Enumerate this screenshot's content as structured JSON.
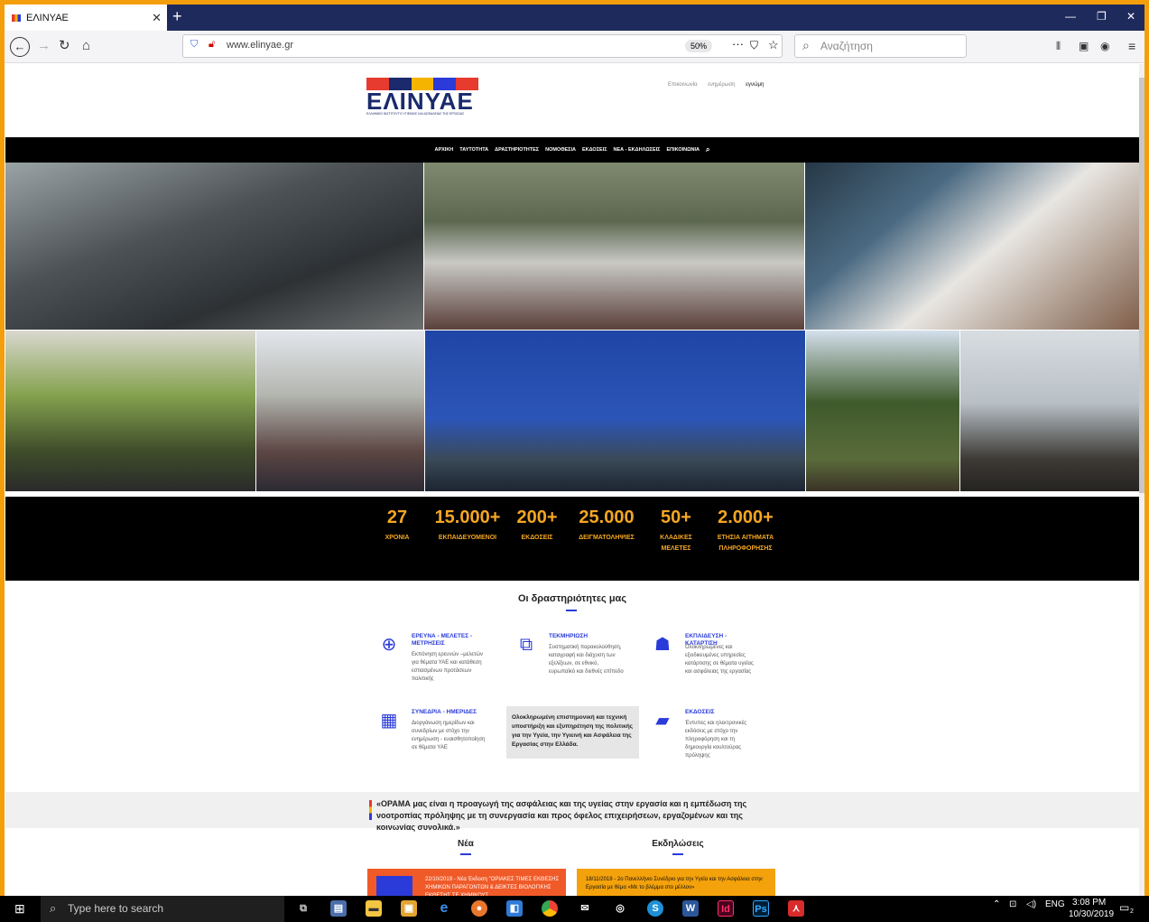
{
  "browser": {
    "tab_title": "ΕΛΙΝΥΑΕ",
    "url": "www.elinyae.gr",
    "zoom": "50%",
    "search_placeholder": "Αναζήτηση"
  },
  "site": {
    "logo_text": "ΕΛΙΝΥΑΕ",
    "logo_subtitle": "ΕΛΛΗΝΙΚΟ ΙΝΣΤΙΤΟΥΤΟ ΥΓΙΕΙΝΗΣ ΚΑΙ ΑΣΦΑΛΕΙΑΣ ΤΗΣ ΕΡΓΑΣΙΑΣ",
    "top_links": [
      "Επικοινωνία",
      "ενημέρωση",
      "εγνώμη"
    ],
    "menu": [
      "ΑΡΧΙΚΗ",
      "ΤΑΥΤΟΤΗΤΑ",
      "ΔΡΑΣΤΗΡΙΟΤΗΤΕΣ",
      "ΝΟΜΟΘΕΣΙΑ",
      "ΕΚΔΟΣΕΙΣ",
      "ΝΕΑ - ΕΚΔΗΛΩΣΕΙΣ",
      "ΕΠΙΚΟΙΝΩΝΙΑ"
    ]
  },
  "stats": [
    {
      "value": "27",
      "label": "ΧΡΟΝΙΑ"
    },
    {
      "value": "15.000+",
      "label": "ΕΚΠΑΙΔΕΥΟΜΕΝΟΙ"
    },
    {
      "value": "200+",
      "label": "ΕΚΔΟΣΕΙΣ"
    },
    {
      "value": "25.000",
      "label": "ΔΕΙΓΜΑΤΟΛΗΨΙΕΣ"
    },
    {
      "value": "50+",
      "label": "ΚΛΑΔΙΚΕΣ ΜΕΛΕΤΕΣ"
    },
    {
      "value": "2.000+",
      "label": "ΕΤΗΣΙΑ ΑΙΤΗΜΑΤΑ ΠΛΗΡΟΦΟΡΗΣΗΣ"
    }
  ],
  "activities": {
    "title": "Οι δραστηριότητες μας",
    "items": [
      {
        "title": "ΕΡΕΥΝΑ - ΜΕΛΕΤΕΣ - ΜΕΤΡΗΣΕΙΣ",
        "desc": "Εκπόνηση ερευνών –μελετών για θέματα ΥΑΕ και κατάθεση εστιασμένων προτάσεων πολιτικής"
      },
      {
        "title": "ΤΕΚΜΗΡΙΩΣΗ",
        "desc": "Συστηματική παρακολούθηση, καταγραφή και διάχυση των εξελίξεων, σε εθνικό, ευρωπαϊκό και διεθνές επίπεδο"
      },
      {
        "title": "ΕΚΠΑΙΔΕΥΣΗ - ΚΑΤΑΡΤΙΣΗ",
        "desc": "Ολοκληρωμένες και εξειδικευμένες υπηρεσίες κατάρτισης σε θέματα υγείας και ασφάλειας της εργασίας"
      },
      {
        "title": "ΣΥΝΕΔΡΙΑ - ΗΜΕΡΙΔΕΣ",
        "desc": "Διοργάνωση ημερίδων και συνεδρίων με στόχο την ενημέρωση - ευαισθητοποίηση σε θέματα ΥΑΕ"
      },
      {
        "title": "ΕΚΔΟΣΕΙΣ",
        "desc": "Έντυπες και ηλεκτρονικές εκδόσεις με στόχο την πληροφόρηση και τη δημιουργία κουλτούρας πρόληψης"
      }
    ],
    "center_text": "Ολοκληρωμένη επιστημονική και τεχνική υποστήριξη και εξυπηρέτηση της πολιτικής για την Υγεία, την Υγιεινή και Ασφάλεια της Εργασίας στην Ελλάδα."
  },
  "vision": "«ΟΡΑΜΑ μας είναι η προαγωγή της ασφάλειας και της υγείας στην εργασία και η εμπέδωση της νοοτροπίας πρόληψης με τη συνεργασία και προς όφελος επιχειρήσεων, εργαζομένων και της κοινωνίας συνολικά.»",
  "news": {
    "title": "Νέα",
    "item": "22/10/2019 - Νέα Έκδοση \"ΟΡΙΑΚΕΣ ΤΙΜΕΣ ΕΚΘΕΣΗΣ ΧΗΜΙΚΩΝ ΠΑΡΑΓΟΝΤΩΝ & ΔΕΙΚΤΕΣ ΒΙΟΛΟΓΙΚΗΣ ΕΚΘΕΣΗΣ ΣΕ ΧΗΜΙΚΟΥΣ"
  },
  "events": {
    "title": "Εκδηλώσεις",
    "item": "18/11/2019 - 2ο Πανελλήνιο Συνέδριο για την Υγεία και την Ασφάλεια στην Εργασία με θέμα «Με το βλέμμα στο μέλλον»"
  },
  "taskbar": {
    "search_placeholder": "Type here to search",
    "lang": "ENG",
    "time": "3:08 PM",
    "date": "10/30/2019",
    "notifications": "2"
  }
}
